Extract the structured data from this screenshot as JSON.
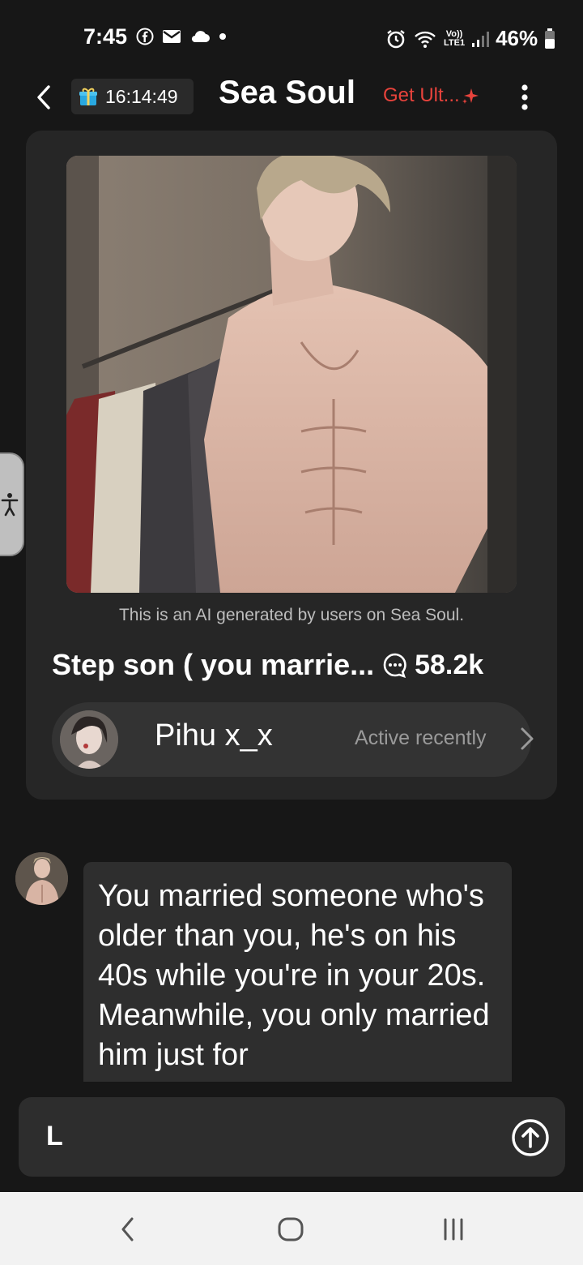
{
  "status_bar": {
    "time": "7:45",
    "battery": "46%",
    "network_label_top": "Vo))",
    "network_label_bottom": "LTE1"
  },
  "header": {
    "timer": "16:14:49",
    "title": "Sea Soul",
    "upgrade_label": "Get Ult..."
  },
  "character": {
    "ai_note": "This is an AI generated by users on Sea Soul.",
    "title": "Step son ( you marrie...",
    "chat_count": "58.2k",
    "creator_name": "Pihu x_x",
    "creator_status": "Active recently"
  },
  "message": {
    "text": "You married someone who's older than you, he's on his 40s while you're in your 20s. Meanwhile, you only married him just for"
  },
  "input": {
    "value": "L"
  },
  "colors": {
    "background": "#171717",
    "card": "#262626",
    "accent_red": "#e8433c",
    "nav_bar": "#f2f2f2"
  }
}
